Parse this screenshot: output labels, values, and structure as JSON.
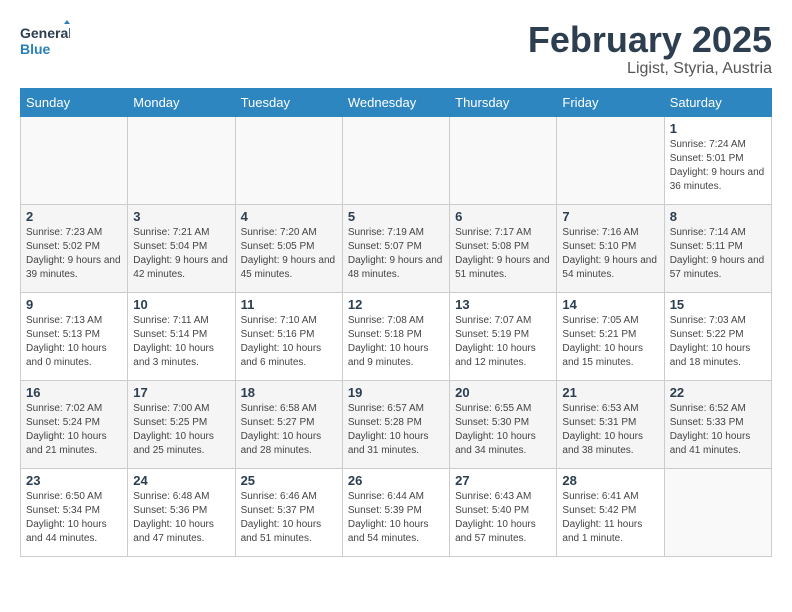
{
  "header": {
    "logo_general": "General",
    "logo_blue": "Blue",
    "month_year": "February 2025",
    "location": "Ligist, Styria, Austria"
  },
  "weekdays": [
    "Sunday",
    "Monday",
    "Tuesday",
    "Wednesday",
    "Thursday",
    "Friday",
    "Saturday"
  ],
  "weeks": [
    [
      {
        "day": "",
        "info": ""
      },
      {
        "day": "",
        "info": ""
      },
      {
        "day": "",
        "info": ""
      },
      {
        "day": "",
        "info": ""
      },
      {
        "day": "",
        "info": ""
      },
      {
        "day": "",
        "info": ""
      },
      {
        "day": "1",
        "info": "Sunrise: 7:24 AM\nSunset: 5:01 PM\nDaylight: 9 hours and 36 minutes."
      }
    ],
    [
      {
        "day": "2",
        "info": "Sunrise: 7:23 AM\nSunset: 5:02 PM\nDaylight: 9 hours and 39 minutes."
      },
      {
        "day": "3",
        "info": "Sunrise: 7:21 AM\nSunset: 5:04 PM\nDaylight: 9 hours and 42 minutes."
      },
      {
        "day": "4",
        "info": "Sunrise: 7:20 AM\nSunset: 5:05 PM\nDaylight: 9 hours and 45 minutes."
      },
      {
        "day": "5",
        "info": "Sunrise: 7:19 AM\nSunset: 5:07 PM\nDaylight: 9 hours and 48 minutes."
      },
      {
        "day": "6",
        "info": "Sunrise: 7:17 AM\nSunset: 5:08 PM\nDaylight: 9 hours and 51 minutes."
      },
      {
        "day": "7",
        "info": "Sunrise: 7:16 AM\nSunset: 5:10 PM\nDaylight: 9 hours and 54 minutes."
      },
      {
        "day": "8",
        "info": "Sunrise: 7:14 AM\nSunset: 5:11 PM\nDaylight: 9 hours and 57 minutes."
      }
    ],
    [
      {
        "day": "9",
        "info": "Sunrise: 7:13 AM\nSunset: 5:13 PM\nDaylight: 10 hours and 0 minutes."
      },
      {
        "day": "10",
        "info": "Sunrise: 7:11 AM\nSunset: 5:14 PM\nDaylight: 10 hours and 3 minutes."
      },
      {
        "day": "11",
        "info": "Sunrise: 7:10 AM\nSunset: 5:16 PM\nDaylight: 10 hours and 6 minutes."
      },
      {
        "day": "12",
        "info": "Sunrise: 7:08 AM\nSunset: 5:18 PM\nDaylight: 10 hours and 9 minutes."
      },
      {
        "day": "13",
        "info": "Sunrise: 7:07 AM\nSunset: 5:19 PM\nDaylight: 10 hours and 12 minutes."
      },
      {
        "day": "14",
        "info": "Sunrise: 7:05 AM\nSunset: 5:21 PM\nDaylight: 10 hours and 15 minutes."
      },
      {
        "day": "15",
        "info": "Sunrise: 7:03 AM\nSunset: 5:22 PM\nDaylight: 10 hours and 18 minutes."
      }
    ],
    [
      {
        "day": "16",
        "info": "Sunrise: 7:02 AM\nSunset: 5:24 PM\nDaylight: 10 hours and 21 minutes."
      },
      {
        "day": "17",
        "info": "Sunrise: 7:00 AM\nSunset: 5:25 PM\nDaylight: 10 hours and 25 minutes."
      },
      {
        "day": "18",
        "info": "Sunrise: 6:58 AM\nSunset: 5:27 PM\nDaylight: 10 hours and 28 minutes."
      },
      {
        "day": "19",
        "info": "Sunrise: 6:57 AM\nSunset: 5:28 PM\nDaylight: 10 hours and 31 minutes."
      },
      {
        "day": "20",
        "info": "Sunrise: 6:55 AM\nSunset: 5:30 PM\nDaylight: 10 hours and 34 minutes."
      },
      {
        "day": "21",
        "info": "Sunrise: 6:53 AM\nSunset: 5:31 PM\nDaylight: 10 hours and 38 minutes."
      },
      {
        "day": "22",
        "info": "Sunrise: 6:52 AM\nSunset: 5:33 PM\nDaylight: 10 hours and 41 minutes."
      }
    ],
    [
      {
        "day": "23",
        "info": "Sunrise: 6:50 AM\nSunset: 5:34 PM\nDaylight: 10 hours and 44 minutes."
      },
      {
        "day": "24",
        "info": "Sunrise: 6:48 AM\nSunset: 5:36 PM\nDaylight: 10 hours and 47 minutes."
      },
      {
        "day": "25",
        "info": "Sunrise: 6:46 AM\nSunset: 5:37 PM\nDaylight: 10 hours and 51 minutes."
      },
      {
        "day": "26",
        "info": "Sunrise: 6:44 AM\nSunset: 5:39 PM\nDaylight: 10 hours and 54 minutes."
      },
      {
        "day": "27",
        "info": "Sunrise: 6:43 AM\nSunset: 5:40 PM\nDaylight: 10 hours and 57 minutes."
      },
      {
        "day": "28",
        "info": "Sunrise: 6:41 AM\nSunset: 5:42 PM\nDaylight: 11 hours and 1 minute."
      },
      {
        "day": "",
        "info": ""
      }
    ]
  ]
}
